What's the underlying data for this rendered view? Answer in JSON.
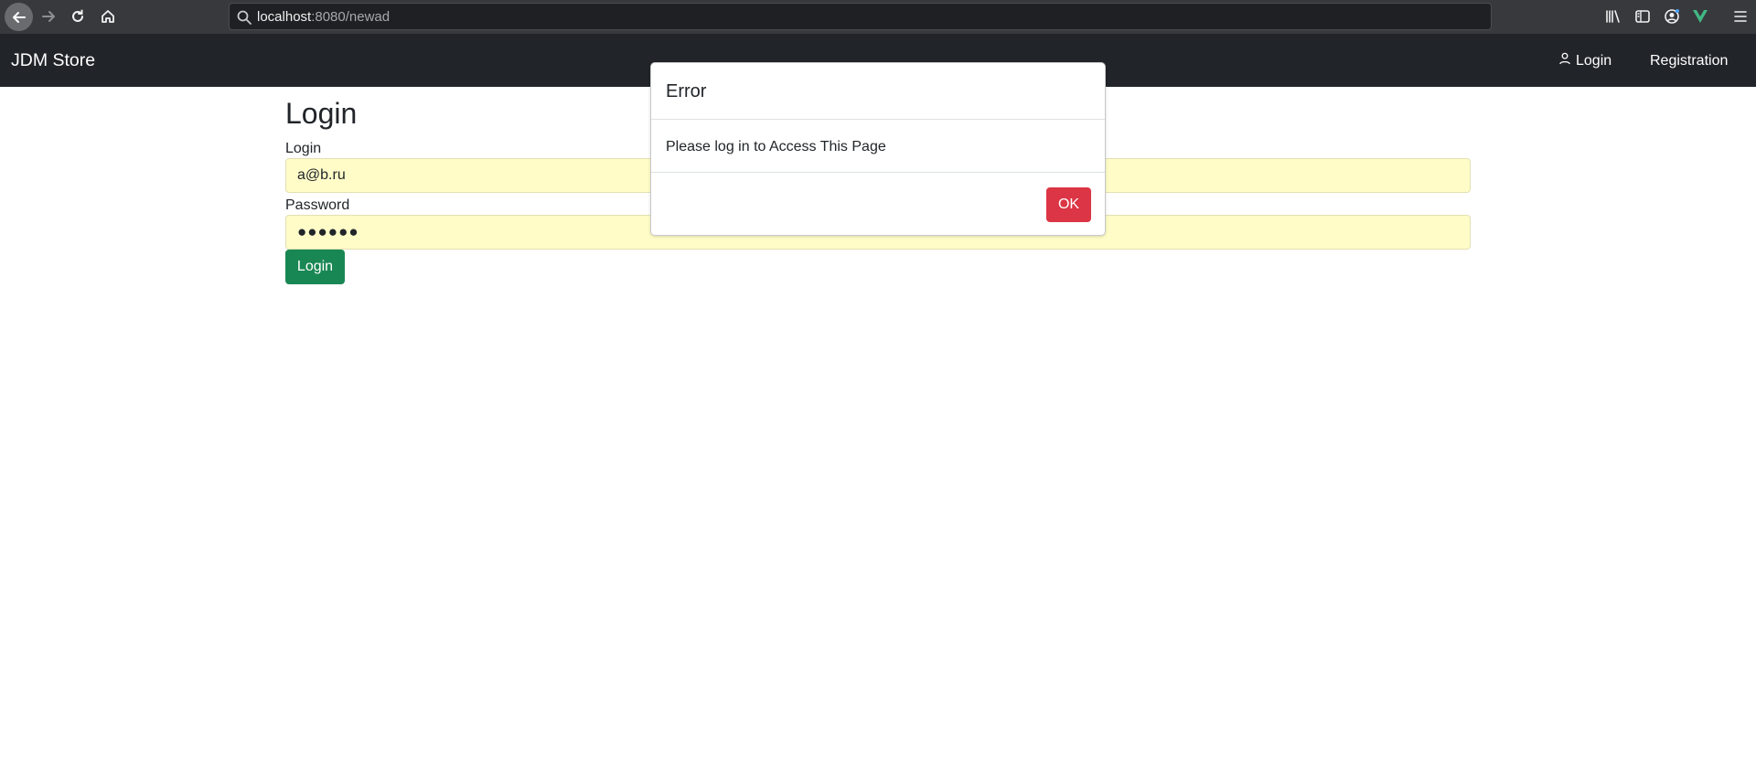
{
  "browser": {
    "url_host": "localhost",
    "url_rest": ":8080/newad",
    "icons": [
      "back-icon",
      "forward-icon",
      "reload-icon",
      "home-icon",
      "search-icon",
      "library-icon",
      "sidebar-icon",
      "account-icon",
      "vue-devtools-icon",
      "menu-icon"
    ]
  },
  "navbar": {
    "brand": "JDM Store",
    "login_link": "Login",
    "registration_link": "Registration"
  },
  "form": {
    "title": "Login",
    "login_label": "Login",
    "login_value": "a@b.ru",
    "password_label": "Password",
    "password_value": "●●●●●●",
    "submit_label": "Login"
  },
  "modal": {
    "title": "Error",
    "message": "Please log in to Access This Page",
    "ok_label": "OK"
  },
  "colors": {
    "navbar_bg": "#212529",
    "success": "#198754",
    "danger": "#dc3545",
    "autofill_bg": "#fffcc8"
  }
}
